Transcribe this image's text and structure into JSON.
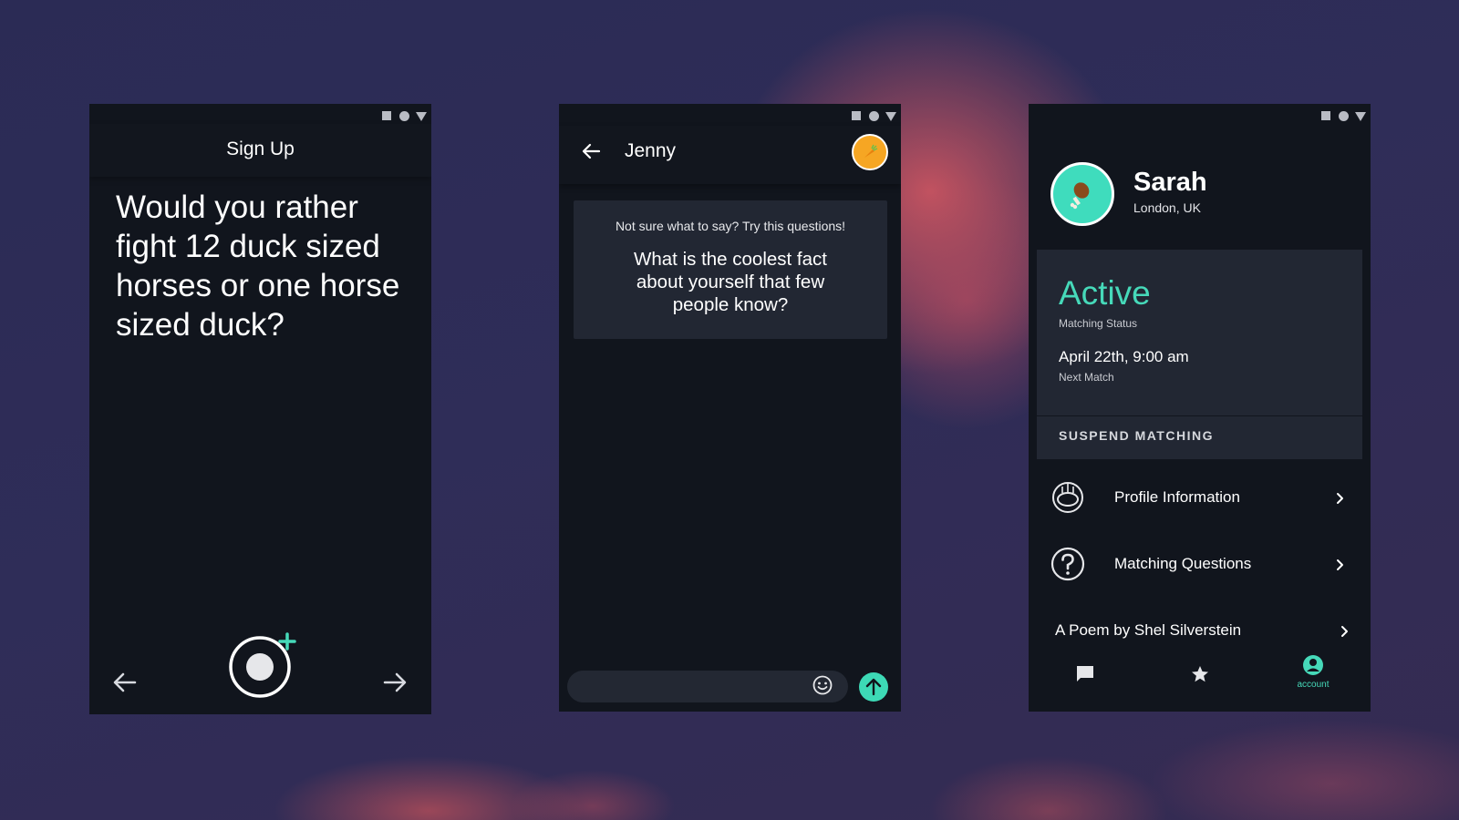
{
  "signup": {
    "title": "Sign Up",
    "question": "Would you rather fight 12 duck sized horses or one horse sized duck?"
  },
  "chat": {
    "contact_name": "Jenny",
    "hint": "Not sure what to say? Try this questions!",
    "prompt": "What is the coolest fact about yourself that few people know?",
    "message_placeholder": ""
  },
  "account": {
    "user_name": "Sarah",
    "location": "London, UK",
    "status_value": "Active",
    "status_label": "Matching Status",
    "next_match_value": "April 22th, 9:00 am",
    "next_match_label": "Next Match",
    "suspend_label": "SUSPEND MATCHING",
    "menu": [
      {
        "label": "Profile Information",
        "icon": "helmet-icon"
      },
      {
        "label": "Matching Questions",
        "icon": "question-circle-icon"
      },
      {
        "label": "A Poem by Shel Silverstein",
        "icon": ""
      }
    ],
    "nav": [
      {
        "icon": "chat-icon",
        "label": ""
      },
      {
        "icon": "star-icon",
        "label": ""
      },
      {
        "icon": "account-icon",
        "label": "account"
      }
    ]
  },
  "colors": {
    "accent": "#46d9b9",
    "avatar_orange": "#f6a623",
    "screen_bg": "#11151d",
    "card_bg": "#222733"
  }
}
